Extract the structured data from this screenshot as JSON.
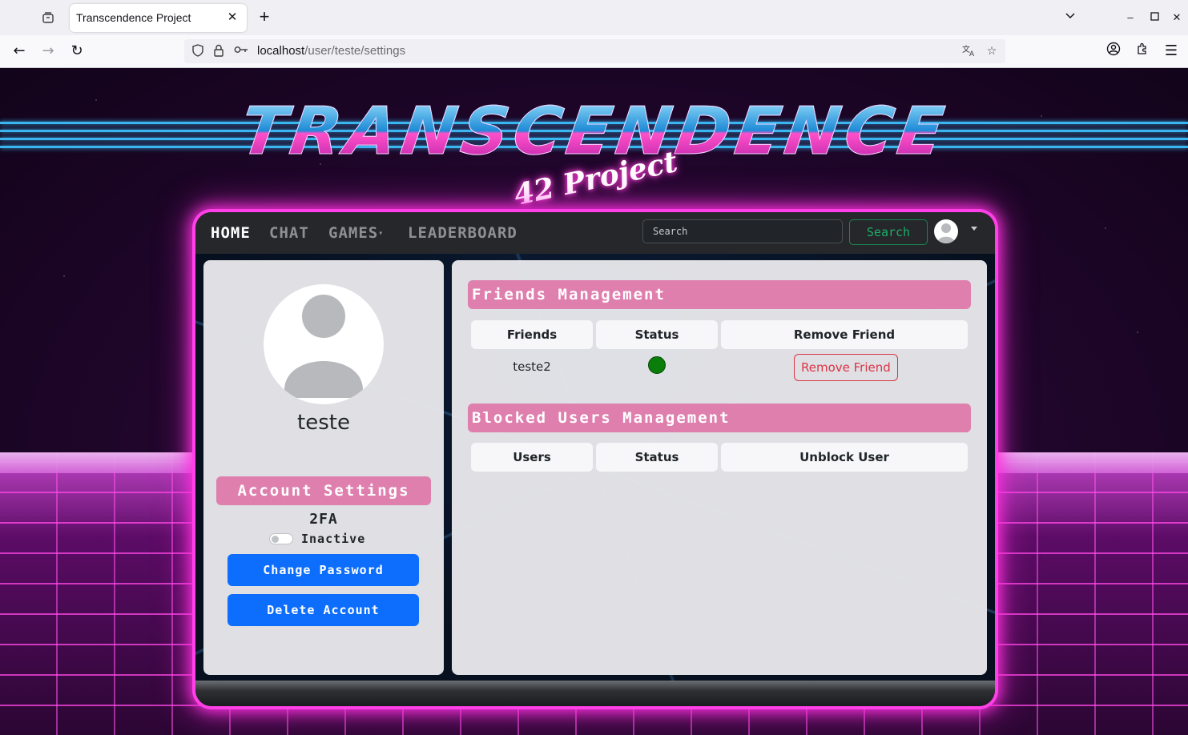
{
  "browser": {
    "tab_title": "Transcendence Project",
    "url_host": "localhost",
    "url_path": "/user/teste/settings"
  },
  "site": {
    "logo_title": "TRANSCENDENCE",
    "logo_subtitle": "42 Project"
  },
  "topnav": {
    "links": [
      {
        "label": "HOME",
        "active": true
      },
      {
        "label": "CHAT",
        "active": false
      },
      {
        "label": "GAMES",
        "active": false
      },
      {
        "label": "LEADERBOARD",
        "active": false
      }
    ],
    "search_placeholder": "Search",
    "search_button": "Search"
  },
  "profile": {
    "username": "teste",
    "account_settings_title": "Account Settings",
    "twofa_label": "2FA",
    "twofa_status": "Inactive",
    "change_password_label": "Change Password",
    "delete_account_label": "Delete Account"
  },
  "friends": {
    "title": "Friends Management",
    "columns": [
      "Friends",
      "Status",
      "Remove Friend"
    ],
    "rows": [
      {
        "name": "teste2",
        "status": "online",
        "action": "Remove Friend"
      }
    ]
  },
  "blocked": {
    "title": "Blocked Users Management",
    "columns": [
      "Users",
      "Status",
      "Unblock User"
    ],
    "rows": []
  },
  "colors": {
    "accent_pink": "#df7fae",
    "primary_blue": "#0d6efd",
    "danger_red": "#dc3545",
    "success_green": "#198754",
    "online_dot": "#0a7d0a",
    "neon_border": "#ff40e8"
  }
}
